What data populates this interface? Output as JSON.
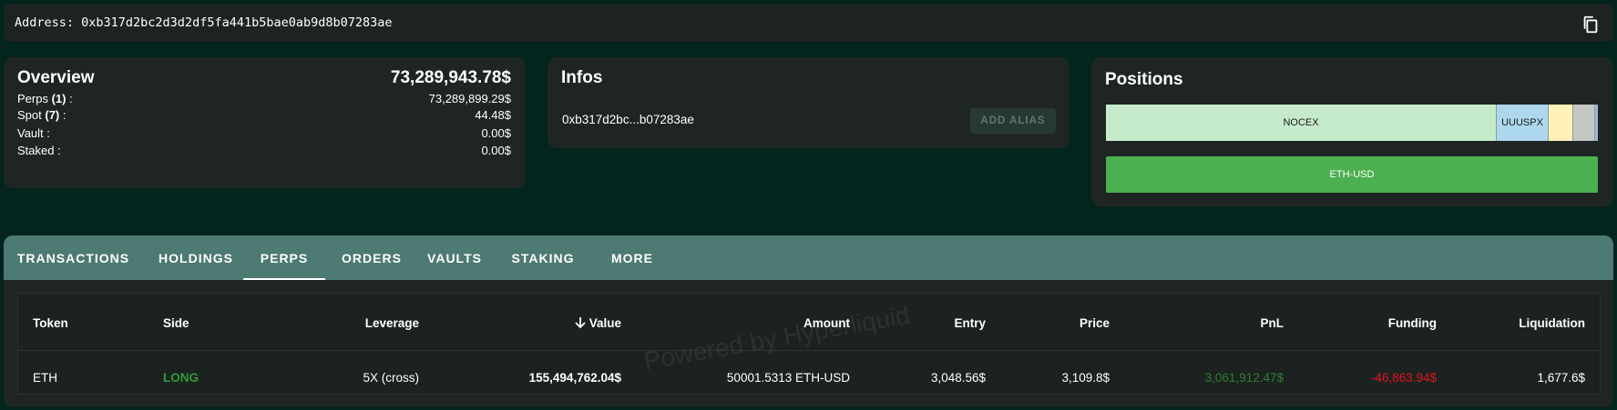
{
  "address_bar": {
    "label": "Address: 0xb317d2bc2d3d2df5fa441b5bae0ab9d8b07283ae",
    "copy_icon": "copy-icon"
  },
  "overview": {
    "title": "Overview",
    "total": "73,289,943.78$",
    "rows": [
      {
        "label_pre": "Perps ",
        "label_count": "(1)",
        "label_post": " :",
        "value": "73,289,899.29$"
      },
      {
        "label_pre": "Spot ",
        "label_count": "(7)",
        "label_post": " :",
        "value": "44.48$"
      },
      {
        "label_pre": "Vault :",
        "label_count": "",
        "label_post": "",
        "value": "0.00$"
      },
      {
        "label_pre": "Staked :",
        "label_count": "",
        "label_post": "",
        "value": "0.00$"
      }
    ]
  },
  "infos": {
    "title": "Infos",
    "address_short": "0xb317d2bc...b07283ae",
    "alias_button": "ADD ALIAS"
  },
  "positions": {
    "title": "Positions",
    "segments": [
      {
        "label": "NOCEX",
        "color": "#c6ebcb"
      },
      {
        "label": "UUUSPX",
        "color": "#acd7ec"
      },
      {
        "label": "",
        "color": "#fff1b8"
      },
      {
        "label": "",
        "color": "#c5c7c3"
      },
      {
        "label": "",
        "color": "#9db8d8"
      }
    ],
    "perp_bar": {
      "label": "ETH-USD",
      "color": "#4caf50"
    }
  },
  "tabs": {
    "items": [
      "TRANSACTIONS",
      "HOLDINGS",
      "PERPS",
      "ORDERS",
      "VAULTS",
      "STAKING",
      "MORE"
    ],
    "active": "PERPS"
  },
  "table": {
    "headers": {
      "token": "Token",
      "side": "Side",
      "leverage": "Leverage",
      "value": "Value",
      "amount": "Amount",
      "entry": "Entry",
      "price": "Price",
      "pnl": "PnL",
      "funding": "Funding",
      "liquidation": "Liquidation"
    },
    "rows": [
      {
        "token": "ETH",
        "side": "LONG",
        "leverage": "5X (cross)",
        "value": "155,494,762.04$",
        "amount": "50001.5313 ETH-USD",
        "entry": "3,048.56$",
        "price": "3,109.8$",
        "pnl": "3,061,912.47$",
        "funding": "-46,863.94$",
        "liquidation": "1,677.6$"
      }
    ],
    "colors": {
      "long": "#2e9a3a",
      "pnl_positive": "#2e7d32",
      "funding_negative": "#e3141b"
    }
  },
  "watermark": "Powered by Hyperliquid"
}
